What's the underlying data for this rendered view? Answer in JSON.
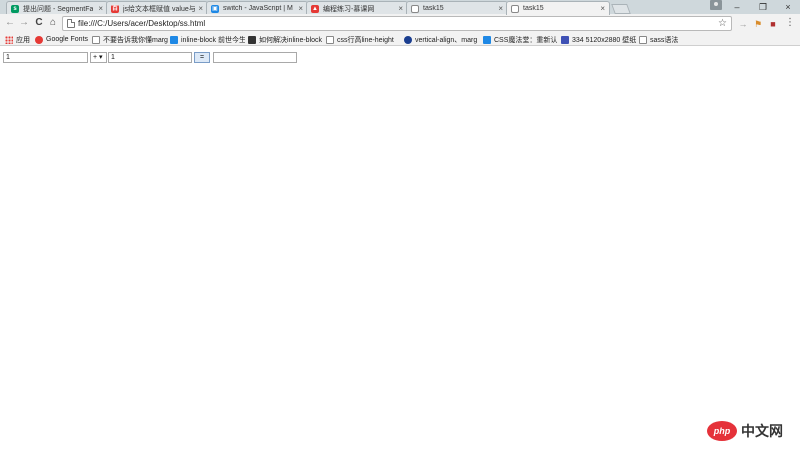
{
  "tabs": [
    {
      "title": "提出问题 - SegmentFa",
      "icon_color": "#009a61",
      "icon_glyph": "s",
      "active": false
    },
    {
      "title": "js给文本框赋值 value与",
      "icon_color": "#e53935",
      "icon_glyph": "百",
      "active": false
    },
    {
      "title": "switch - JavaScript | M",
      "icon_color": "#1e88e5",
      "icon_glyph": "▣",
      "active": false
    },
    {
      "title": "编程练习-慕课网",
      "icon_color": "#e53935",
      "icon_glyph": "▲",
      "active": false
    },
    {
      "title": "task15",
      "icon_color": "#ffffff",
      "icon_glyph": "",
      "active": false
    },
    {
      "title": "task15",
      "icon_color": "#ffffff",
      "icon_glyph": "",
      "active": true
    }
  ],
  "tab_close_glyph": "×",
  "window_controls": {
    "minimize": "–",
    "restore": "❐",
    "close": "×"
  },
  "nav": {
    "back": "←",
    "forward": "→",
    "reload": "C",
    "home": "⌂"
  },
  "address": {
    "url": "file:///C:/Users/acer/Desktop/ss.html",
    "star": "☆"
  },
  "extensions": [
    {
      "glyph": "→",
      "color": "#999999"
    },
    {
      "glyph": "⚑",
      "color": "#d98c2b"
    },
    {
      "glyph": "■",
      "color": "#b03030"
    }
  ],
  "menu_glyph": "⋮",
  "bookmarks": [
    {
      "label": "应用",
      "icon": "apps"
    },
    {
      "label": "Google Fonts",
      "icon": "google-fonts",
      "color": "#e53935"
    },
    {
      "label": "不要告诉我你懂marg",
      "icon": "page"
    },
    {
      "label": "inline-block 前世今生",
      "icon": "square",
      "color": "#1e88e5"
    },
    {
      "label": "如何解决inline-block",
      "icon": "square",
      "color": "#333333"
    },
    {
      "label": "css行高line-height",
      "icon": "page"
    },
    {
      "label": "vertical-align、marg",
      "icon": "round",
      "color": "#1a3d8f"
    },
    {
      "label": "CSS魔法堂：重新认",
      "icon": "square",
      "color": "#1e88e5"
    },
    {
      "label": "334 5120x2880 壁纸",
      "icon": "square",
      "color": "#3f51b5"
    },
    {
      "label": "sass语法",
      "icon": "page"
    }
  ],
  "calculator": {
    "operand1": "1",
    "operator": "+ ▾",
    "operand2": "1",
    "equals_label": "=",
    "result": ""
  },
  "watermark": {
    "logo": "php",
    "text": "中文网"
  }
}
